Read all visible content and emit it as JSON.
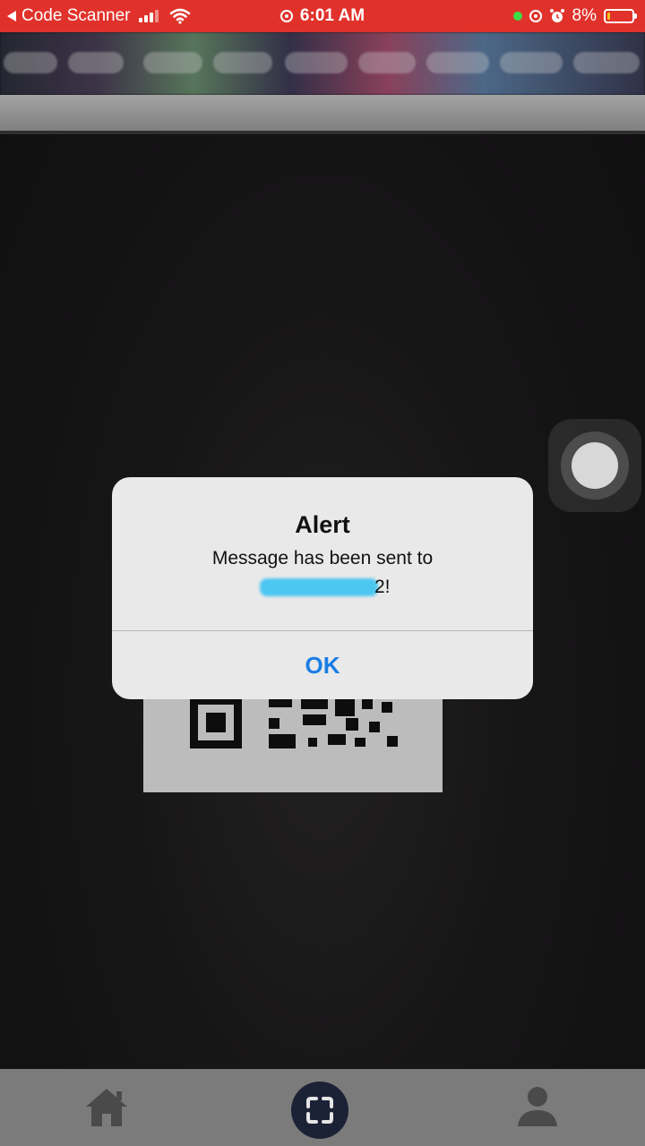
{
  "status_bar": {
    "back_app": "Code Scanner",
    "time": "6:01 AM",
    "battery": "8%"
  },
  "alert": {
    "title": "Alert",
    "message": "Message has been sent to",
    "number_head": "",
    "number_tail": "2!",
    "ok_label": "OK"
  },
  "bottom_nav": {
    "items": [
      {
        "icon": "home-icon"
      },
      {
        "icon": "scan-icon",
        "active": true
      },
      {
        "icon": "profile-icon"
      }
    ]
  },
  "colors": {
    "status_bar": "#e0322b",
    "accent": "#1a7ee4",
    "nav_bg": "#7b7b7b",
    "scan_button": "#1c2236"
  }
}
